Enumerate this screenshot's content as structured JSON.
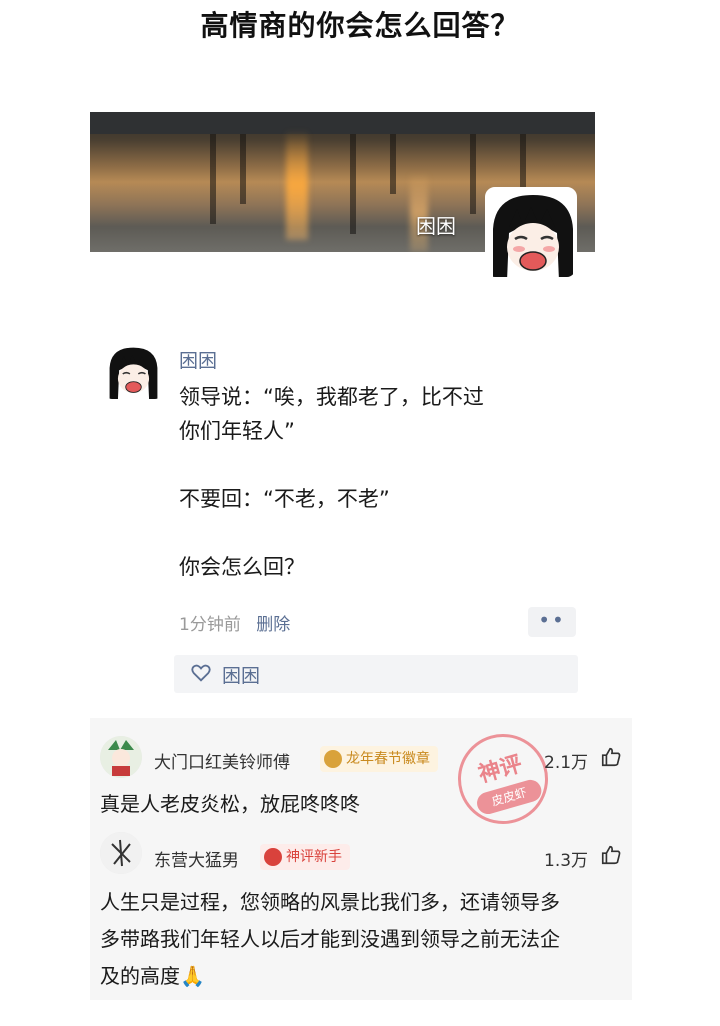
{
  "page": {
    "title": "高情商的你会怎么回答？"
  },
  "profile": {
    "banner_name": "困困"
  },
  "post": {
    "author": "困困",
    "lines": [
      "领导说：“唉，我都老了，比不过",
      "你们年轻人”",
      "",
      "不要回：“不老，不老”",
      "",
      "你会怎么回？"
    ],
    "time": "1分钟前",
    "delete_label": "删除",
    "more_label": "••",
    "liker": "困困"
  },
  "comments": [
    {
      "user": "大门口红美铃师傅",
      "badge": "龙年春节徽章",
      "likes": "2.1万",
      "text": "真是人老皮炎松，放屁咚咚咚"
    },
    {
      "user": "东营大猛男",
      "badge": "神评新手",
      "likes": "1.3万",
      "text_lines": [
        "人生只是过程，您领略的风景比我们多，还请领导多",
        "多带路我们年轻人以后才能到没遇到领导之前无法企",
        "及的高度🙏"
      ]
    }
  ],
  "stamp": {
    "top": "神评",
    "bottom": "皮皮虾"
  },
  "colors": {
    "link": "#5b6f93",
    "badge_gold": "#c98a1e",
    "badge_red": "#d9423c",
    "stamp": "#e87078"
  }
}
